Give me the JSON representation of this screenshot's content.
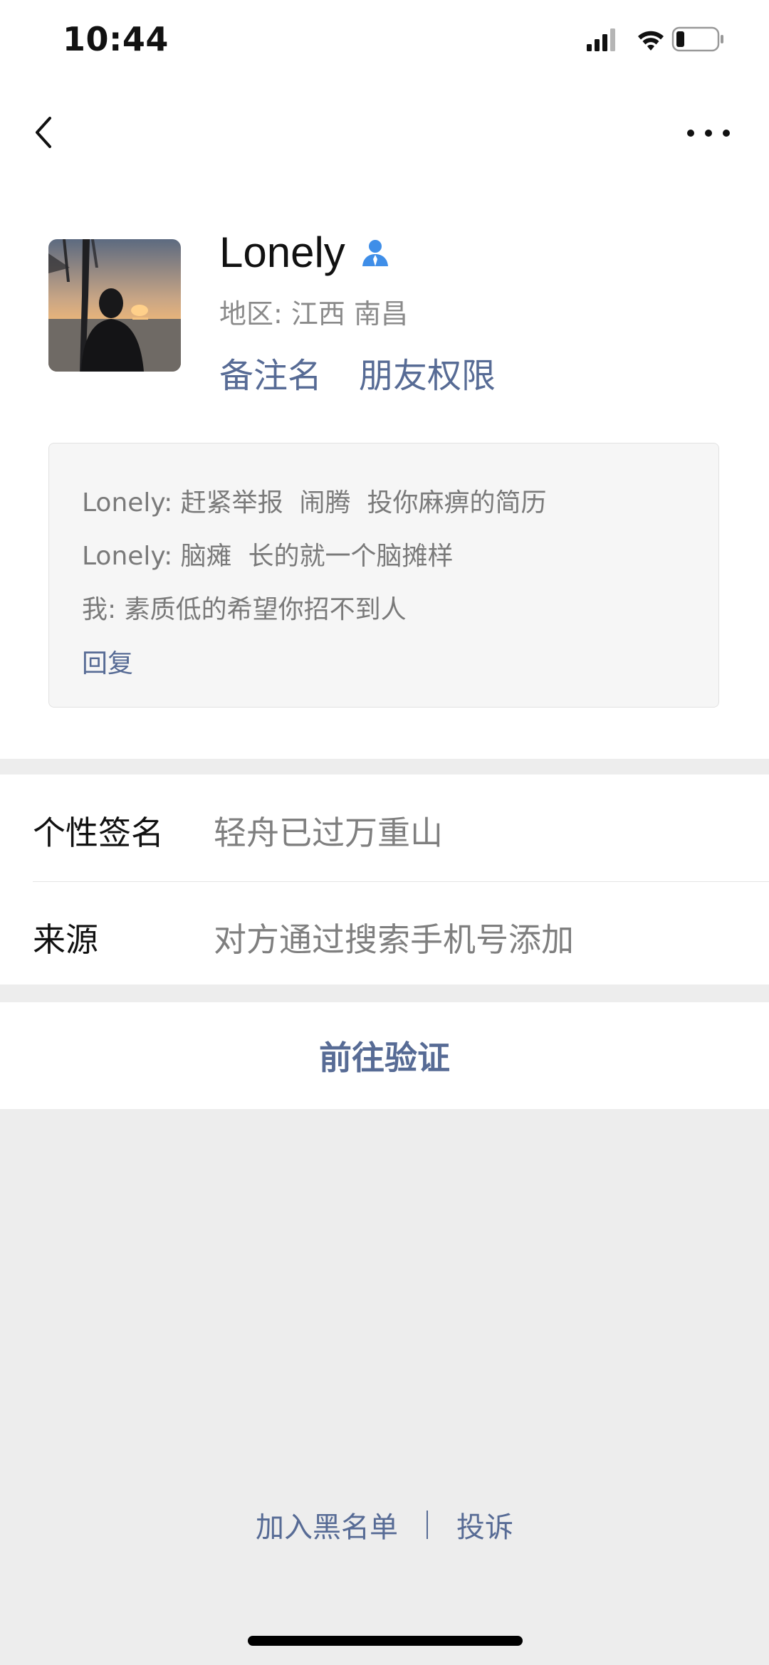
{
  "status_bar": {
    "time": "10:44"
  },
  "profile": {
    "name": "Lonely",
    "region_label": "地区:",
    "region": "江西 南昌",
    "actions": [
      "备注名",
      "朋友权限"
    ]
  },
  "messages": {
    "lines": [
      "Lonely: 赶紧举报  闹腾  投你麻痹的简历",
      "Lonely: 脑瘫  长的就一个脑摊样",
      "我: 素质低的希望你招不到人"
    ],
    "reply_label": "回复"
  },
  "info": [
    {
      "label": "个性签名",
      "value": "轻舟已过万重山"
    },
    {
      "label": "来源",
      "value": "对方通过搜索手机号添加"
    }
  ],
  "verify_button": "前往验证",
  "footer": {
    "blacklist": "加入黑名单",
    "report": "投诉"
  },
  "colors": {
    "link": "#576b95",
    "background": "#ededed",
    "contact_icon": "#3f8ee8"
  },
  "icons": [
    "back-chevron-icon",
    "more-dots-icon",
    "contact-person-icon",
    "signal-icon",
    "wifi-icon",
    "battery-icon"
  ]
}
